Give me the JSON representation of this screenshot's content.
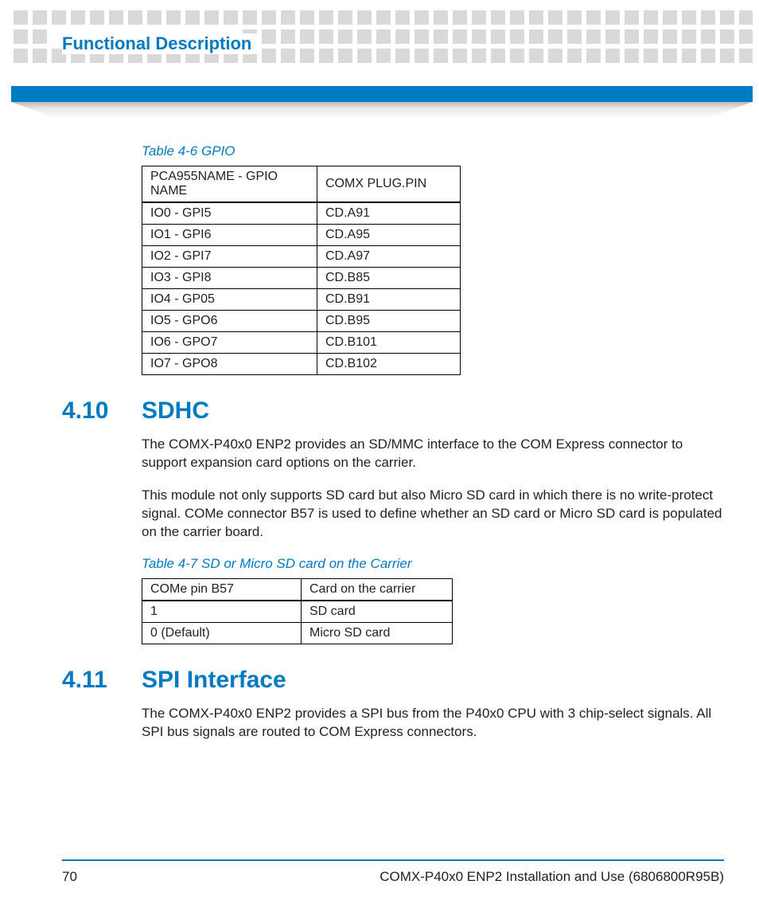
{
  "header": {
    "section_title": "Functional Description"
  },
  "table1": {
    "caption": "Table 4-6 GPIO",
    "headers": {
      "colA": "PCA955NAME - GPIO NAME",
      "colB": "COMX PLUG.PIN"
    },
    "rows": [
      {
        "a": "IO0 - GPI5",
        "b": "CD.A91"
      },
      {
        "a": "IO1 - GPI6",
        "b": "CD.A95"
      },
      {
        "a": "IO2 - GPI7",
        "b": "CD.A97"
      },
      {
        "a": "IO3 - GPI8",
        "b": "CD.B85"
      },
      {
        "a": "IO4 - GP05",
        "b": "CD.B91"
      },
      {
        "a": "IO5 - GPO6",
        "b": "CD.B95"
      },
      {
        "a": "IO6 - GPO7",
        "b": "CD.B101"
      },
      {
        "a": "IO7 - GPO8",
        "b": "CD.B102"
      }
    ]
  },
  "section1": {
    "num": "4.10",
    "title": "SDHC",
    "p1": "The COMX-P40x0 ENP2 provides an SD/MMC interface to the COM Express connector to support expansion card options on the carrier.",
    "p2": "This module not only supports SD card but also Micro SD card in which there is no write-protect signal. COMe connector B57 is used to define whether an SD card or Micro SD card is populated on the carrier board."
  },
  "table2": {
    "caption": "Table 4-7 SD or Micro SD card on the Carrier",
    "headers": {
      "colA": "COMe pin B57",
      "colB": "Card on the carrier"
    },
    "rows": [
      {
        "a": "1",
        "b": "SD card"
      },
      {
        "a": "0 (Default)",
        "b": "Micro SD card"
      }
    ]
  },
  "section2": {
    "num": "4.11",
    "title": "SPI Interface",
    "p1": "The COMX-P40x0 ENP2 provides a SPI bus from the P40x0 CPU with 3 chip-select signals. All SPI bus signals are routed to COM Express connectors."
  },
  "footer": {
    "page": "70",
    "doc": "COMX-P40x0 ENP2 Installation and Use (6806800R95B)"
  }
}
